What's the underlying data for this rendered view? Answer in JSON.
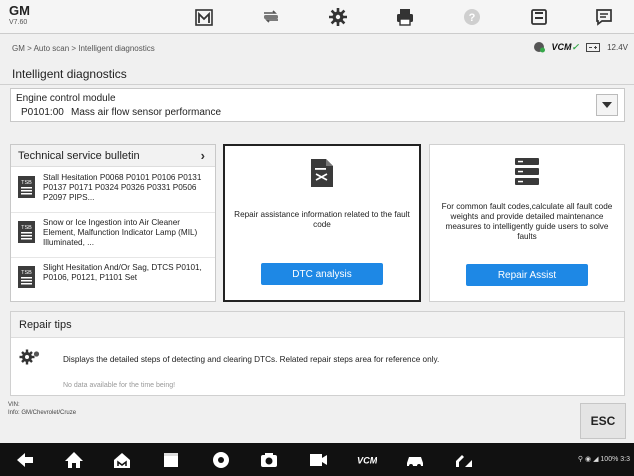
{
  "app": {
    "brand": "GM",
    "version": "V7.60"
  },
  "toolbar": {
    "icons": [
      "home-icon",
      "vehicle-swap-icon",
      "settings-icon",
      "print-icon",
      "help-icon",
      "save-icon",
      "message-icon"
    ]
  },
  "breadcrumb": "GM > Auto scan > Intelligent diagnostics",
  "status": {
    "vcm": "VCM",
    "voltage": "12.4V"
  },
  "page_title": "Intelligent diagnostics",
  "module": {
    "name": "Engine control module",
    "code": "P0101:00",
    "description": "Mass air flow sensor performance"
  },
  "tsb": {
    "title": "Technical service bulletin",
    "items": [
      {
        "text": "Stall Hesitation P0068 P0101 P0106 P0131 P0137 P0171 P0324 P0326 P0331 P0506 P2097 PIPS..."
      },
      {
        "text": "Snow or Ice Ingestion into Air Cleaner Element, Malfunction Indicator Lamp (MIL) Illuminated, ..."
      },
      {
        "text": "Slight Hesitation And/Or Sag, DTCS P0101, P0106, P0121, P1101 Set"
      }
    ]
  },
  "dtc_card": {
    "description": "Repair assistance information related to the fault code",
    "button": "DTC analysis"
  },
  "repair_card": {
    "description": "For common fault codes,calculate all fault code weights and provide detailed maintenance measures to intelligently guide users to solve faults",
    "button": "Repair Assist"
  },
  "repair_tips": {
    "title": "Repair tips",
    "text": "Displays the detailed steps of detecting and clearing DTCs. Related repair steps area for reference only.",
    "no_data": "No data available for the time being!"
  },
  "footer": {
    "vin_label": "VIN:",
    "info": "Info: GM/Chevrolet/Cruze",
    "esc": "ESC"
  },
  "system_tray": {
    "battery": "100%",
    "time": "3:3"
  },
  "colors": {
    "accent": "#1e88e5",
    "vcm_green": "#37a84a",
    "nav_bg": "#111111"
  }
}
